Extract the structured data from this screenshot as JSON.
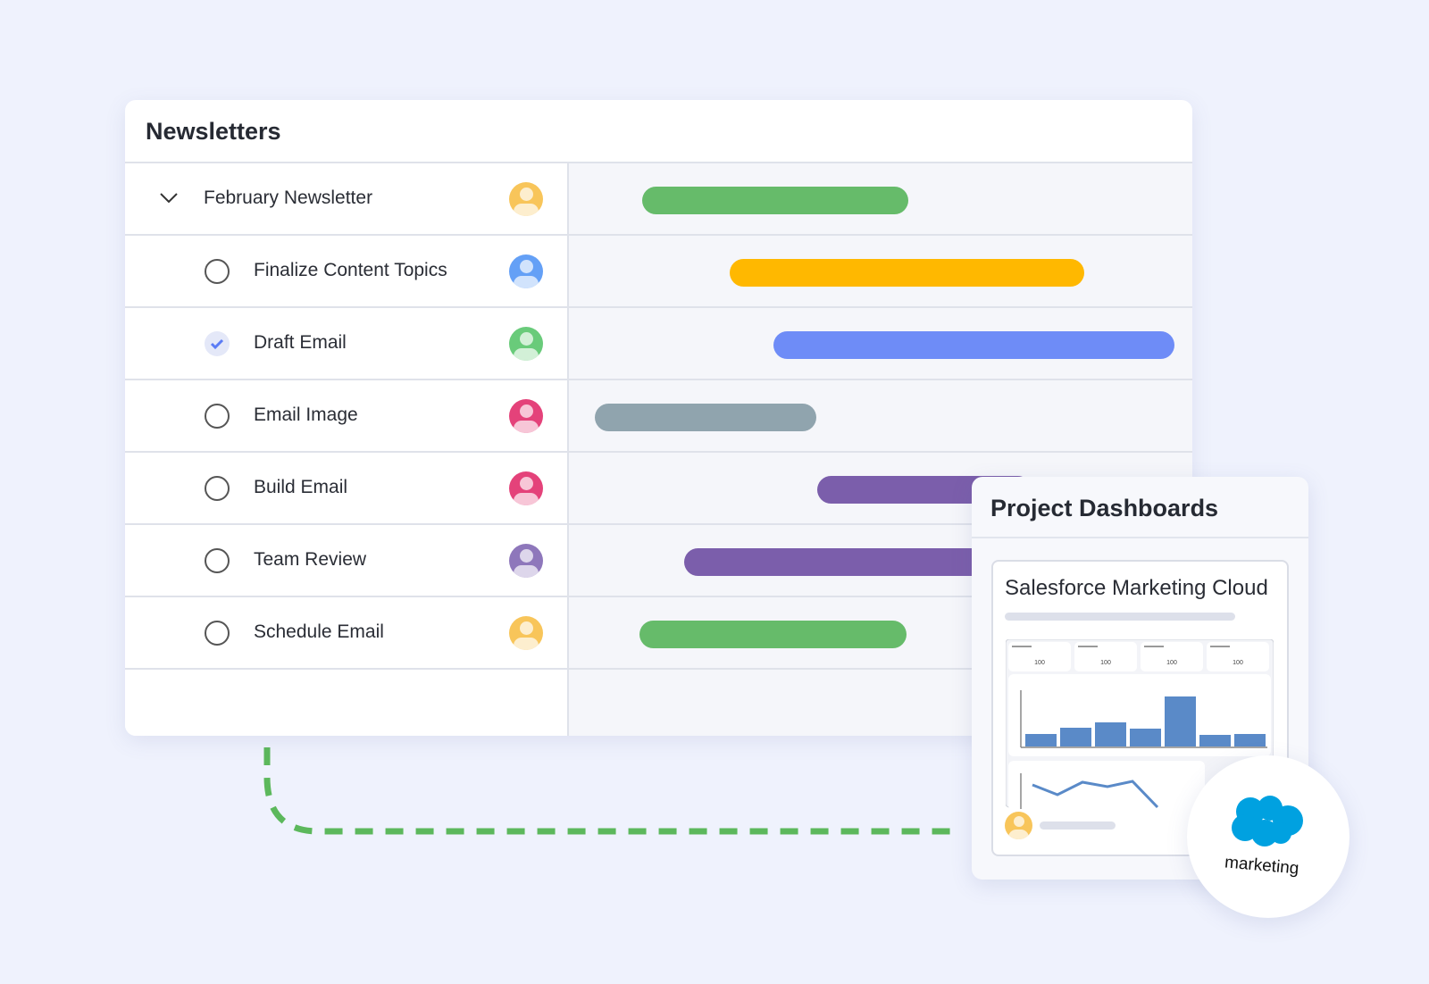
{
  "newsletters": {
    "title": "Newsletters",
    "parent": {
      "label": "February Newsletter",
      "avatar_color": "#f8c55a",
      "bar_color": "#66bb6a"
    },
    "tasks": [
      {
        "label": "Finalize Content Topics",
        "done": false,
        "avatar_color": "#64a0f6",
        "bar_color": "#ffb800"
      },
      {
        "label": "Draft Email",
        "done": true,
        "avatar_color": "#69cb7a",
        "bar_color": "#6e8cf7"
      },
      {
        "label": "Email Image",
        "done": false,
        "avatar_color": "#e4427a",
        "bar_color": "#90a4ae"
      },
      {
        "label": "Build Email",
        "done": false,
        "avatar_color": "#e4427a",
        "bar_color": "#7b5eab"
      },
      {
        "label": "Team Review",
        "done": false,
        "avatar_color": "#8e77bb",
        "bar_color": "#7b5eab"
      },
      {
        "label": "Schedule Email",
        "done": false,
        "avatar_color": "#f8c55a",
        "bar_color": "#66bb6a"
      }
    ]
  },
  "dashboards": {
    "title": "Project Dashboards",
    "card_title": "Salesforce Marketing Cloud",
    "kpis": [
      "100",
      "100",
      "100",
      "100"
    ],
    "bar_color": "#5a8ac8"
  },
  "logo": {
    "text": "marketing",
    "color": "#00a1e0"
  },
  "connector_color": "#5cb85c"
}
